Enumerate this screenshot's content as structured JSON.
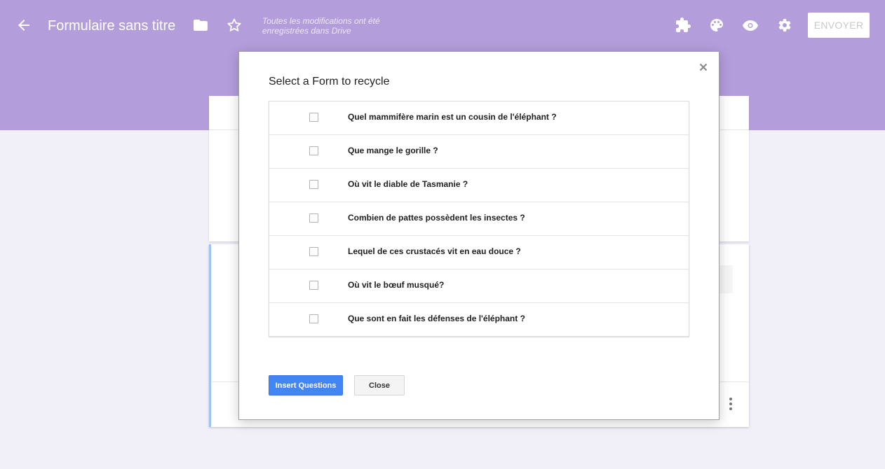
{
  "header": {
    "title": "Formulaire sans titre",
    "saved_status": "Toutes les modifications ont été enregistrées dans Drive",
    "send_label": "ENVOYER",
    "icons": [
      "arrow-back-icon",
      "folder-icon",
      "star-icon",
      "puzzle-icon",
      "palette-icon",
      "eye-icon",
      "gear-icon"
    ],
    "bg_color": "#b39ddb"
  },
  "dialog": {
    "title": "Select a Form to recycle",
    "questions": [
      "Quel mammifère marin est un cousin de l'éléphant ?",
      "Que mange le gorille ?",
      "Où vit le diable de Tasmanie ?",
      "Combien de pattes possèdent les insectes ?",
      "Lequel de ces crustacés vit en eau douce ?",
      "Où vit le bœuf musqué?",
      "Que sont en fait les défenses de l'éléphant ?"
    ],
    "insert_label": "Insert Questions",
    "close_label": "Close",
    "accent_color": "#4285f4"
  }
}
